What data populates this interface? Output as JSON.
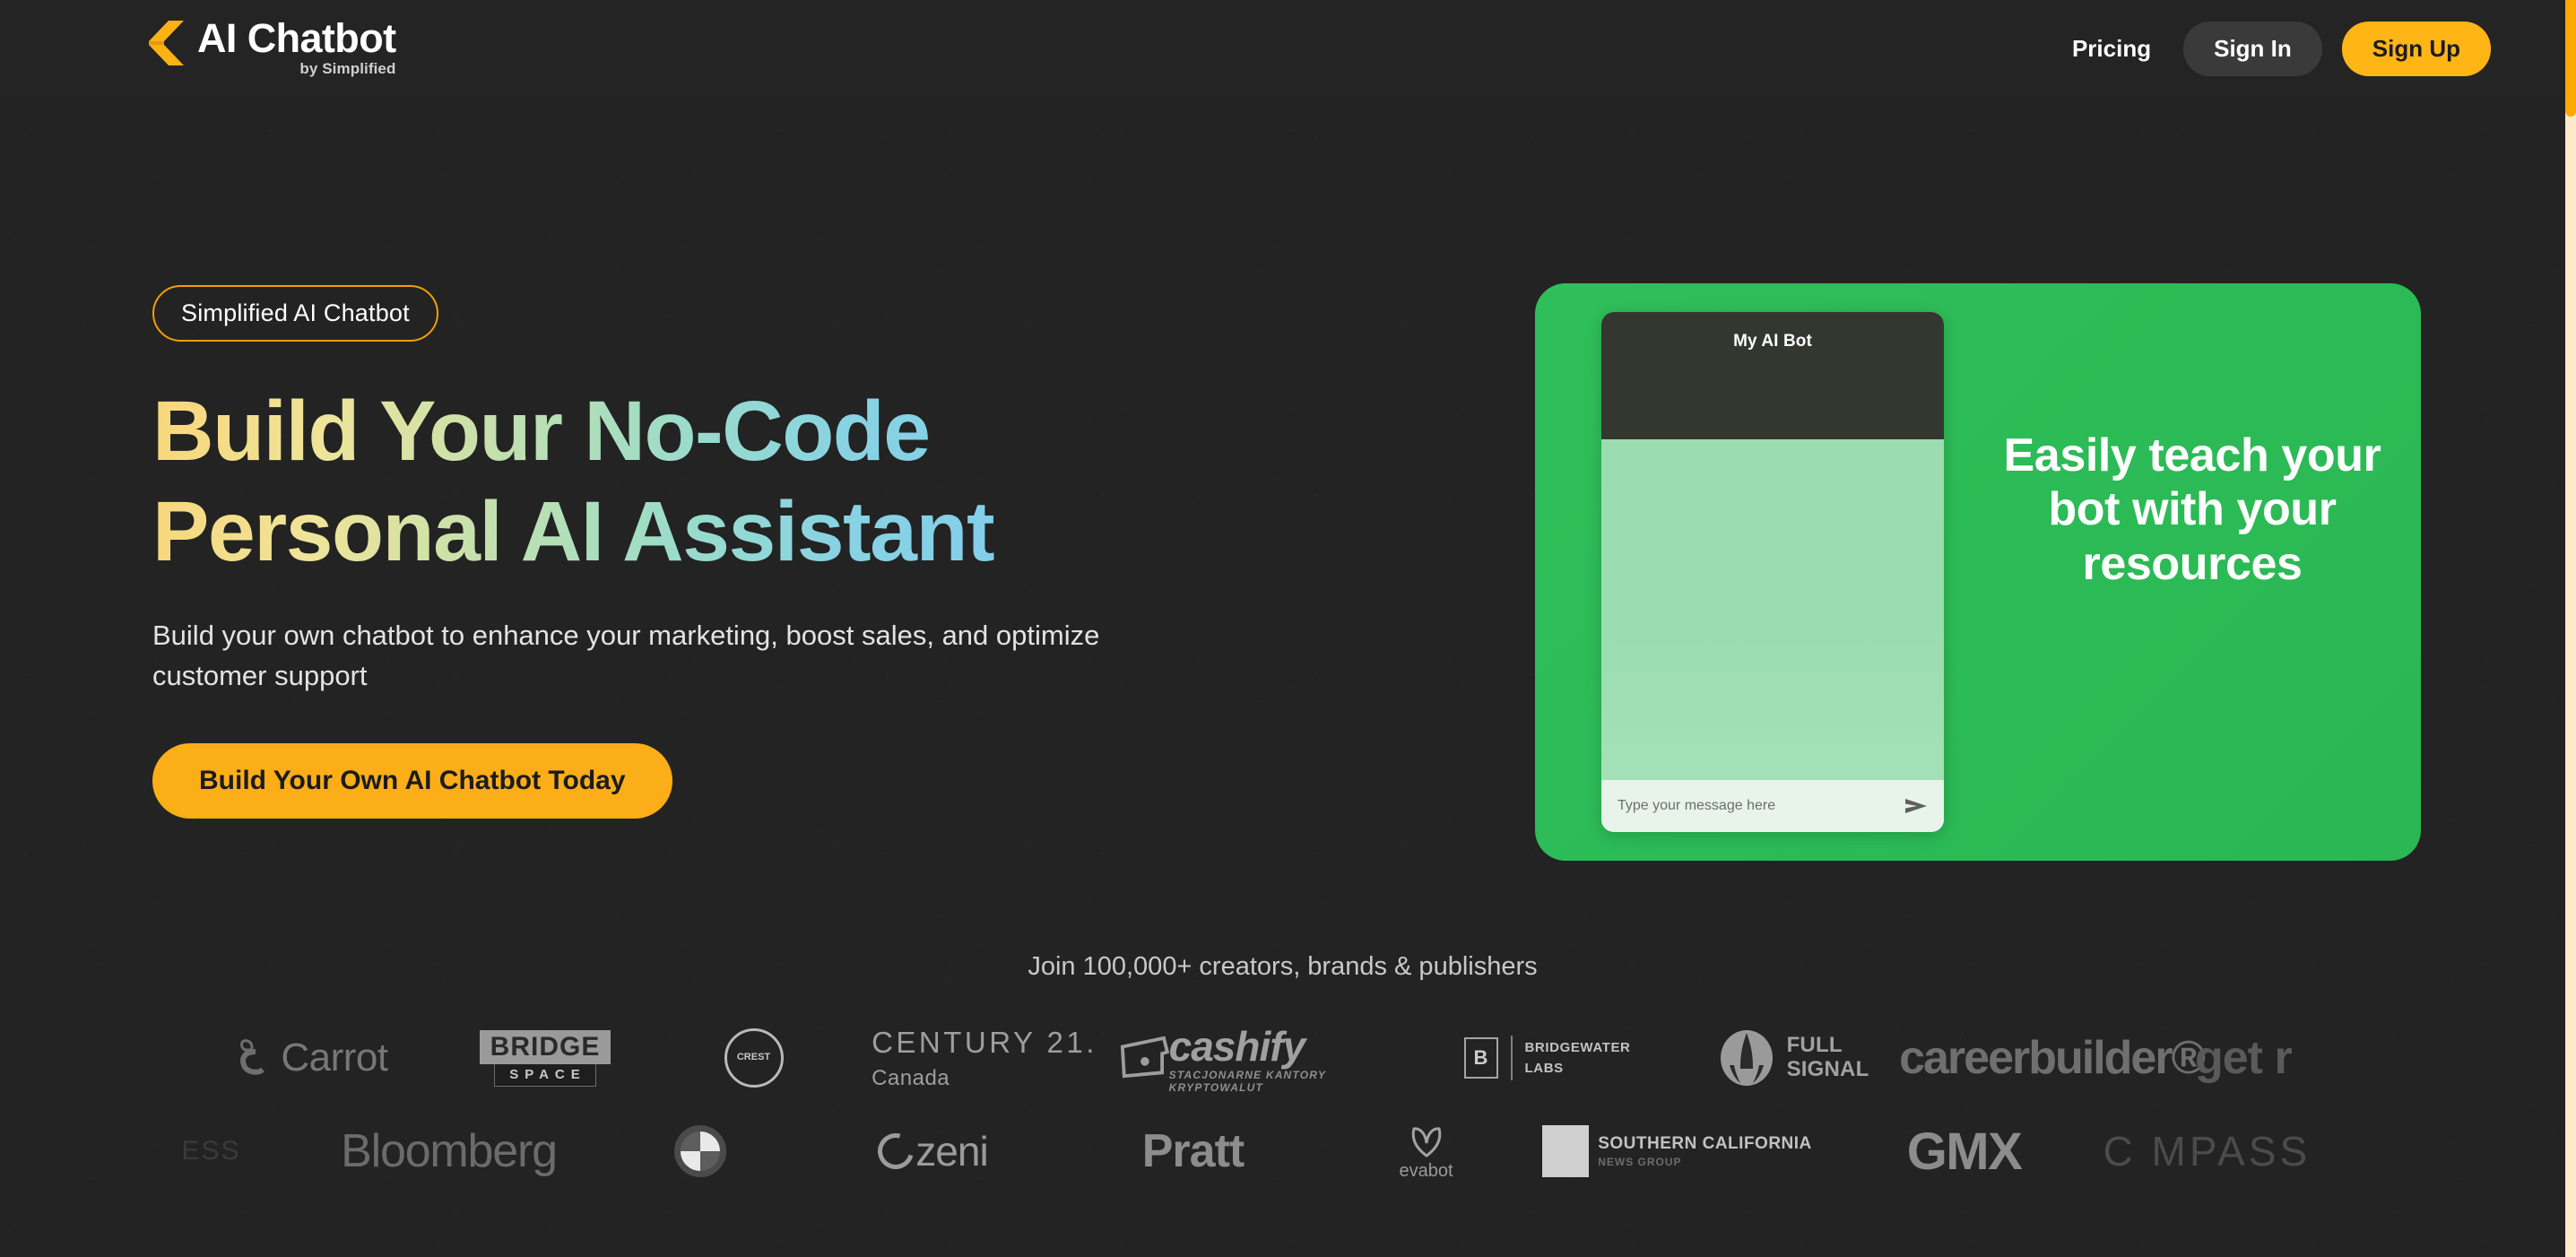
{
  "header": {
    "brand": {
      "logo_icon": "simplified-bolt-logo",
      "title": "AI Chatbot",
      "subtitle": "by Simplified"
    },
    "nav": {
      "pricing_label": "Pricing",
      "sign_in_label": "Sign In",
      "sign_up_label": "Sign Up"
    }
  },
  "colors": {
    "accent_yellow": "#FFB515",
    "cta_yellow": "#FBAE17",
    "badge_border": "#F0A000",
    "card_green": "#2CBB56",
    "page_background": "#242424",
    "scrollbar_thumb": "#FFA800",
    "scrollbar_track": "#FCEACB"
  },
  "hero": {
    "badge_label": "Simplified AI Chatbot",
    "title": "Build Your No-Code Personal AI Assistant",
    "subtitle": "Build your own chatbot to enhance your marketing, boost sales, and optimize customer support",
    "cta_label": "Build Your Own AI Chatbot Today"
  },
  "showcase_card": {
    "headline": "Easily teach your bot with your resources",
    "chat_widget": {
      "header_title": "My AI Bot",
      "input_placeholder": "Type your message here",
      "send_icon": "send-paper-plane-icon"
    }
  },
  "social_proof": {
    "heading": "Join 100,000+ creators, brands & publishers",
    "logo_rows": [
      [
        {
          "name": "carrot",
          "label": "Carrot"
        },
        {
          "name": "bridge-space",
          "label_top": "BRIDGE",
          "label_bottom": "SPACE"
        },
        {
          "name": "crest-emblem",
          "label": "CREST"
        },
        {
          "name": "century-21",
          "label_top": "CENTURY 21.",
          "label_bottom": "Canada"
        },
        {
          "name": "cashify",
          "label_top": "cashify",
          "label_bottom": "STACJONARNE KANTORY KRYPTOWALUT"
        },
        {
          "name": "bridgewater-labs",
          "label_top": "BRIDGEWATER",
          "label_bottom": "LABS",
          "mark": "B"
        },
        {
          "name": "full-signal",
          "label_top": "FULL",
          "label_bottom": "SIGNAL"
        },
        {
          "name": "careerbuilder",
          "label": "careerbuilder®"
        },
        {
          "name": "get-r",
          "label": "get r"
        }
      ],
      [
        {
          "name": "essay",
          "label": "ESS"
        },
        {
          "name": "bloomberg",
          "label": "Bloomberg"
        },
        {
          "name": "bmw",
          "label": "BMW"
        },
        {
          "name": "zeni",
          "label": "zeni"
        },
        {
          "name": "pratt",
          "label": "Pratt"
        },
        {
          "name": "evabot",
          "label": "evabot"
        },
        {
          "name": "southern-california-news-group",
          "label_top": "SOUTHERN CALIFORNIA",
          "label_bottom": "NEWS GROUP"
        },
        {
          "name": "gmx",
          "label": "GMX"
        },
        {
          "name": "compass",
          "label": "C MPASS"
        }
      ]
    ]
  },
  "scrollbar": {
    "thumb_position_percent": 0
  }
}
